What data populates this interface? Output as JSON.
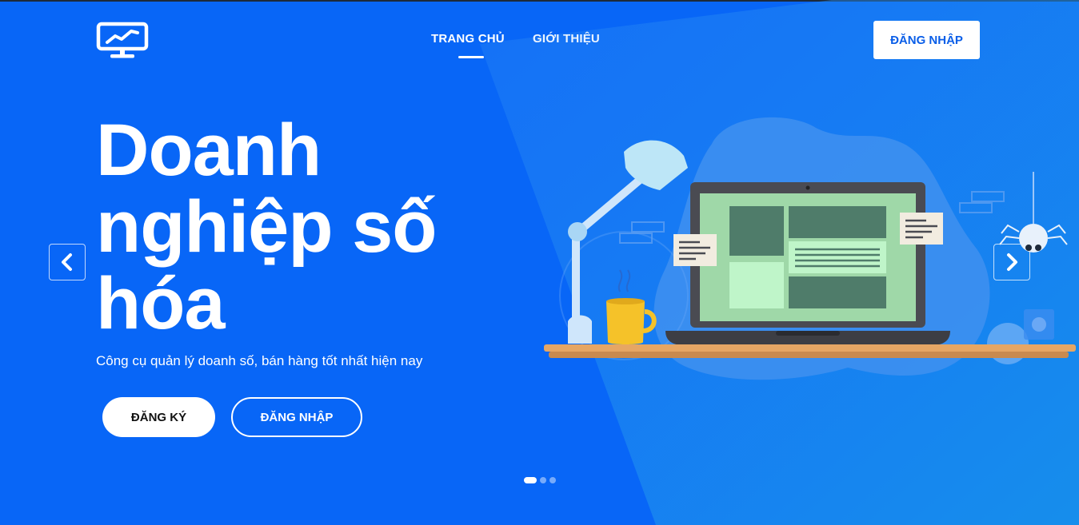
{
  "colors": {
    "background": "#0866f7",
    "accent": "#0a5ee8",
    "white": "#ffffff"
  },
  "logo": {
    "icon": "monitor-chart-icon"
  },
  "nav": {
    "items": [
      {
        "label": "TRANG CHỦ",
        "active": true
      },
      {
        "label": "GIỚI THIỆU",
        "active": false
      }
    ],
    "login_label": "ĐĂNG NHẬP"
  },
  "hero": {
    "title_lines": [
      "Doanh",
      "nghiệp số",
      "hóa"
    ],
    "subtitle": "Công cụ quản lý doanh số, bán hàng tốt nhất hiện nay",
    "register_label": "ĐĂNG KÝ",
    "login_label": "ĐĂNG NHẬP"
  },
  "carousel": {
    "prev_icon": "chevron-left-icon",
    "next_icon": "chevron-right-icon",
    "slide_count": 3,
    "active_slide": 1
  },
  "illustration": {
    "icon": "laptop-desk-illustration"
  }
}
